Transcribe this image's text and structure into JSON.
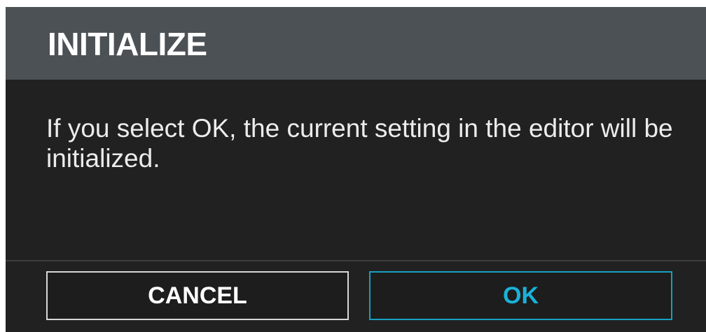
{
  "dialog": {
    "title": "INITIALIZE",
    "message": "If you select OK, the current setting in the editor will be initialized.",
    "cancel_label": "CANCEL",
    "ok_label": "OK"
  },
  "colors": {
    "title_bar": "#4b5154",
    "body": "#212121",
    "ok_accent": "#19b2d8",
    "cancel_border": "#d8d8d8"
  }
}
